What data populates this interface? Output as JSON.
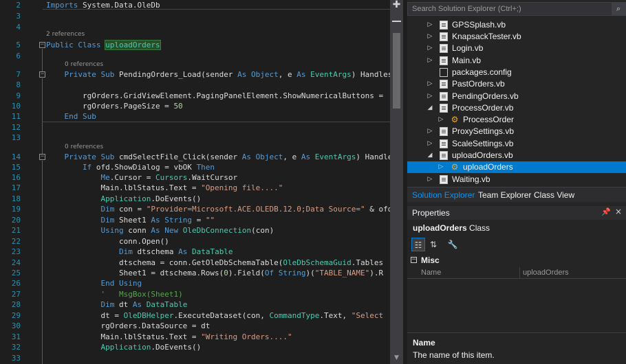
{
  "editor": {
    "line_numbers": [
      "2",
      "3",
      "4",
      "5",
      "6",
      "7",
      "8",
      "9",
      "10",
      "11",
      "12",
      "13",
      "14",
      "15",
      "16",
      "17",
      "18",
      "19",
      "20",
      "21",
      "22",
      "23",
      "24",
      "25",
      "26",
      "27",
      "28",
      "29",
      "30",
      "31",
      "32",
      "33"
    ],
    "references_2": "2 references",
    "references_0": "0 references",
    "fold_open": "−"
  },
  "solution_explorer": {
    "search_placeholder": "Search Solution Explorer (Ctrl+;)",
    "search_button": "⌕",
    "items": [
      {
        "label": "GPSSplash.vb",
        "icon": "vb-file-icon",
        "arrow": "▷"
      },
      {
        "label": "KnapsackTester.vb",
        "icon": "vb-file-icon",
        "arrow": "▷"
      },
      {
        "label": "Login.vb",
        "icon": "vb-file-icon",
        "arrow": "▷"
      },
      {
        "label": "Main.vb",
        "icon": "vb-file-icon",
        "arrow": "▷"
      },
      {
        "label": "packages.config",
        "icon": "config-file-icon",
        "arrow": ""
      },
      {
        "label": "PastOrders.vb",
        "icon": "vb-file-icon",
        "arrow": "▷"
      },
      {
        "label": "PendingOrders.vb",
        "icon": "vb-file-icon",
        "arrow": "▷"
      },
      {
        "label": "ProcessOrder.vb",
        "icon": "vb-file-icon",
        "arrow": "◢"
      },
      {
        "label": "ProcessOrder",
        "icon": "class-icon",
        "arrow": "▷"
      },
      {
        "label": "ProxySettings.vb",
        "icon": "vb-file-icon",
        "arrow": "▷"
      },
      {
        "label": "ScaleSettings.vb",
        "icon": "vb-file-icon",
        "arrow": "▷"
      },
      {
        "label": "uploadOrders.vb",
        "icon": "vb-file-icon",
        "arrow": "◢"
      },
      {
        "label": "uploadOrders",
        "icon": "class-icon",
        "arrow": "▷"
      },
      {
        "label": "Waiting.vb",
        "icon": "vb-file-icon",
        "arrow": "▷"
      }
    ],
    "tabs": [
      "Solution Explorer",
      "Team Explorer",
      "Class View"
    ]
  },
  "properties": {
    "title": "Properties",
    "pin": "🖈",
    "close": "×",
    "object_name": "uploadOrders",
    "object_type": "Class",
    "category": "Misc",
    "category_toggle": "−",
    "prop_name": "Name",
    "prop_value": "uploadOrders",
    "desc_name": "Name",
    "desc_text": "The name of this item."
  }
}
